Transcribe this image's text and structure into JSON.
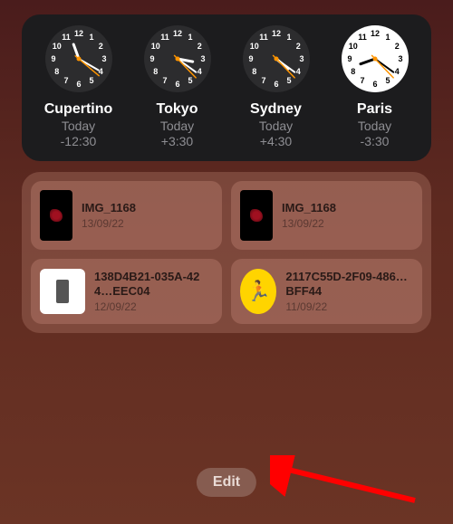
{
  "clocks": [
    {
      "city": "Cupertino",
      "day": "Today",
      "offset": "-12:30",
      "face": "dark",
      "h": 11,
      "m": 20
    },
    {
      "city": "Tokyo",
      "day": "Today",
      "offset": "+3:30",
      "face": "dark",
      "h": 3,
      "m": 21
    },
    {
      "city": "Sydney",
      "day": "Today",
      "offset": "+4:30",
      "face": "dark",
      "h": 4,
      "m": 21
    },
    {
      "city": "Paris",
      "day": "Today",
      "offset": "-3:30",
      "face": "light",
      "h": 8,
      "m": 21
    }
  ],
  "files": [
    {
      "name": "IMG_1168",
      "date": "13/09/22",
      "thumb": "photo-dark"
    },
    {
      "name": "IMG_1168",
      "date": "13/09/22",
      "thumb": "photo-dark"
    },
    {
      "name": "138D4B21-035A-424…EEC04",
      "date": "12/09/22",
      "thumb": "photo-white"
    },
    {
      "name": "2117C55D-2F09-486…BFF44",
      "date": "11/09/22",
      "thumb": "runner"
    }
  ],
  "edit": {
    "label": "Edit"
  }
}
